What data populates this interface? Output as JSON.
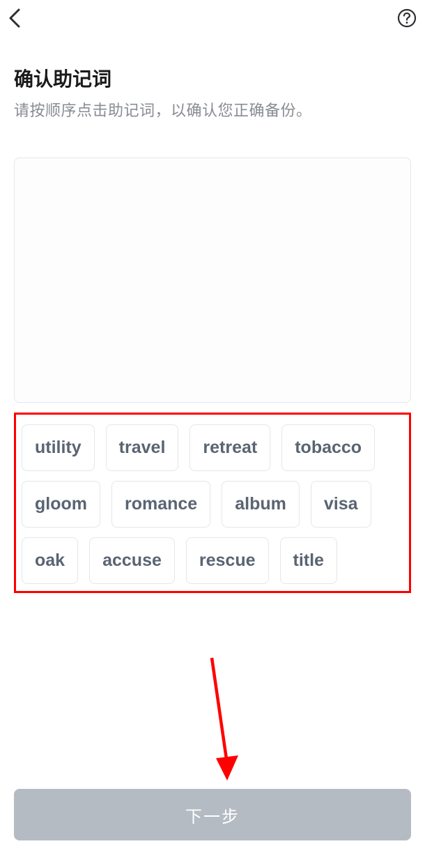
{
  "header": {
    "back_icon": "chevron-left",
    "help_icon": "question-circle"
  },
  "title": "确认助记词",
  "subtitle": "请按顺序点击助记词，以确认您正确备份。",
  "words": [
    "utility",
    "travel",
    "retreat",
    "tobacco",
    "gloom",
    "romance",
    "album",
    "visa",
    "oak",
    "accuse",
    "rescue",
    "title"
  ],
  "next_button_label": "下一步",
  "annotations": {
    "highlight_color": "#ff0000",
    "arrow_color": "#ff0000"
  }
}
